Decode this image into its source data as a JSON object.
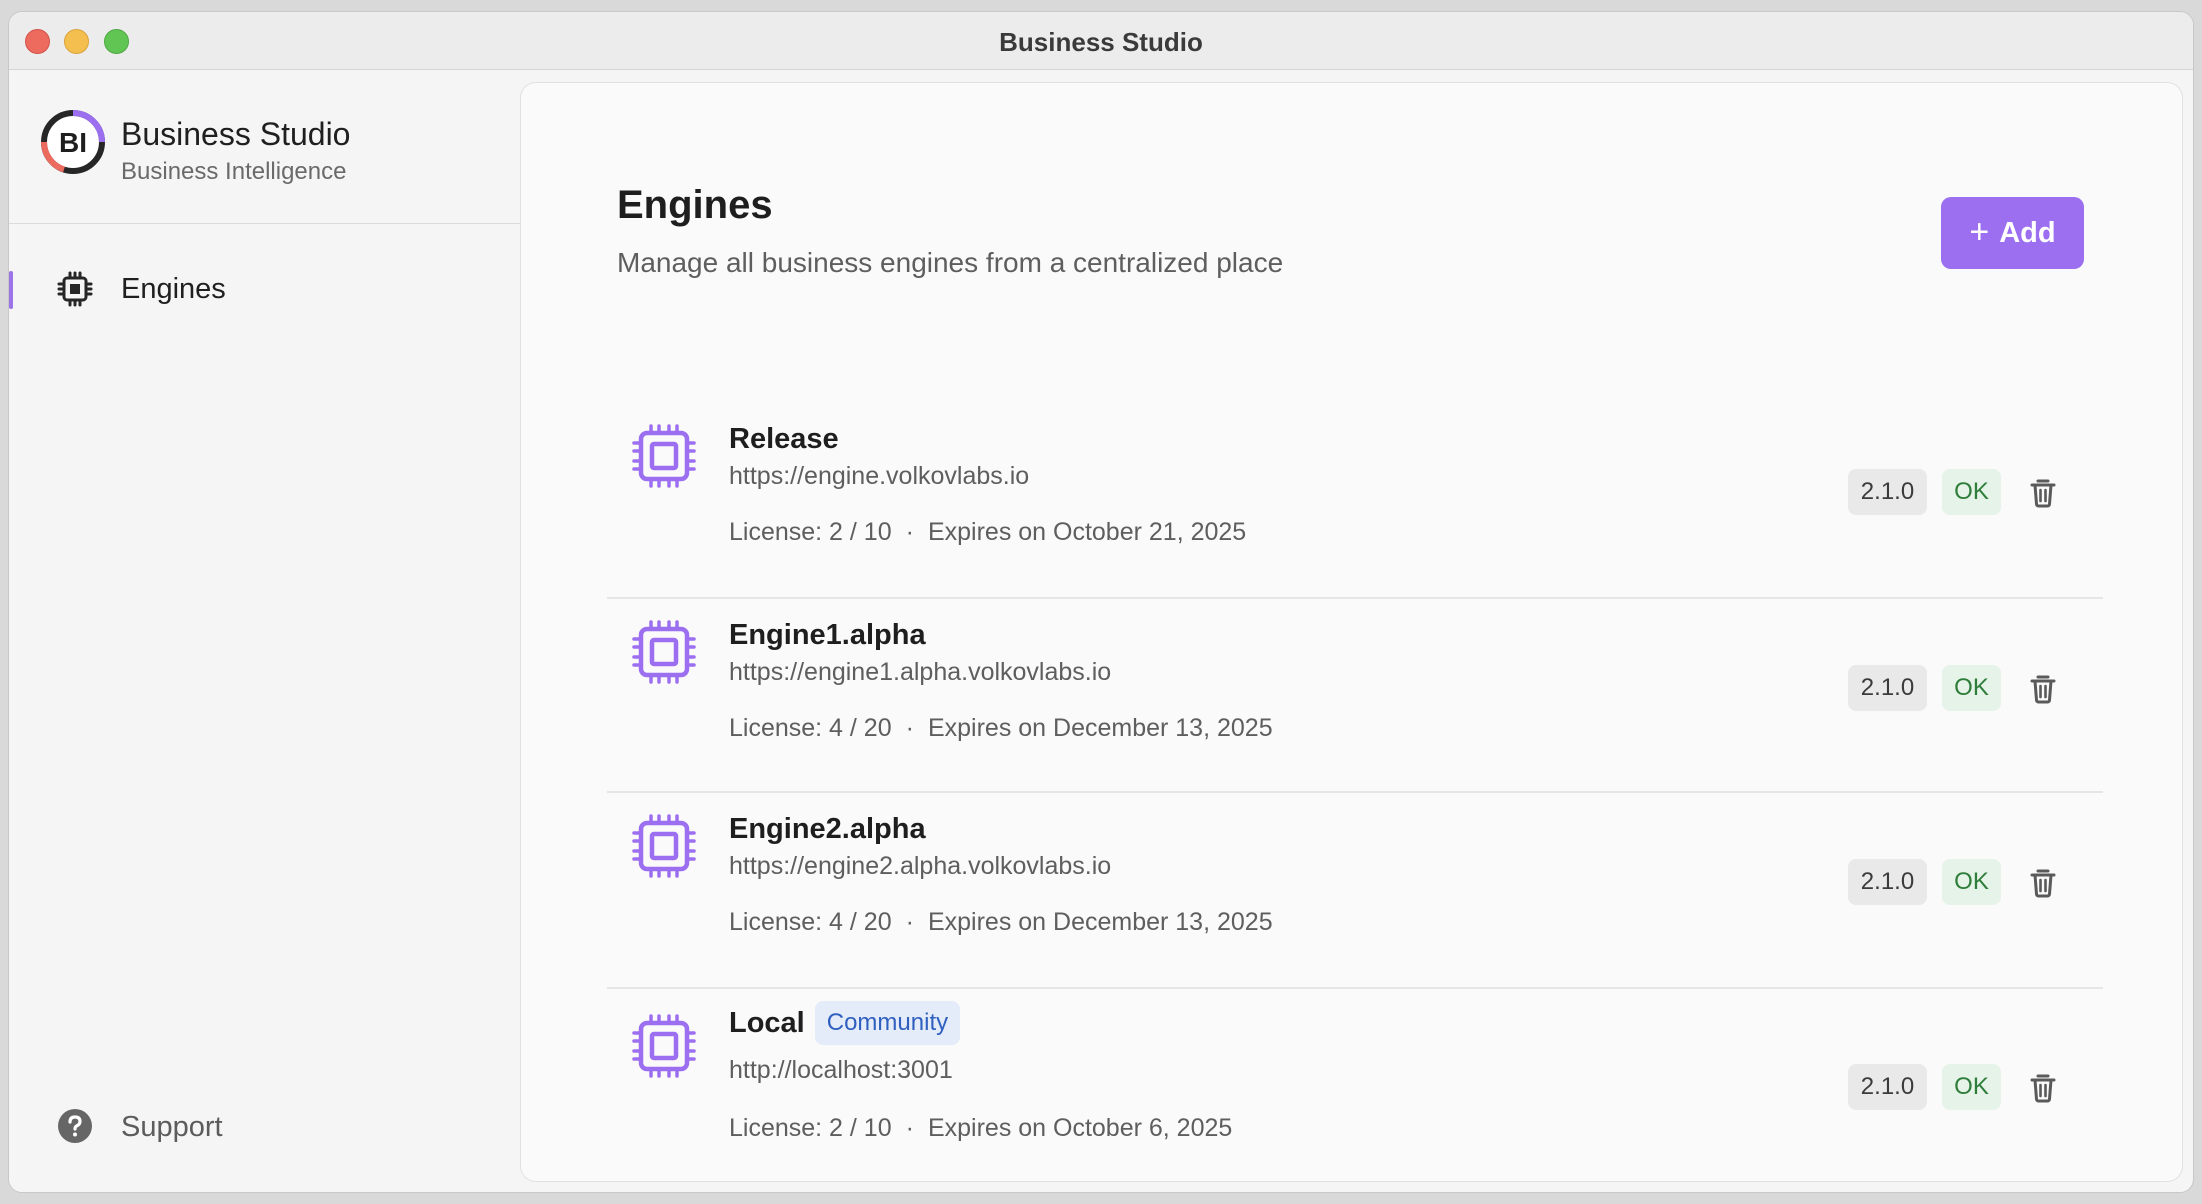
{
  "window": {
    "title": "Business Studio"
  },
  "sidebar": {
    "brand": {
      "name": "Business Studio",
      "subtitle": "Business Intelligence",
      "logo_text": "BI"
    },
    "nav": [
      {
        "label": "Engines",
        "icon": "chip-icon",
        "active": true
      }
    ],
    "support": {
      "label": "Support",
      "icon": "question-circle-icon"
    }
  },
  "main": {
    "title": "Engines",
    "subtitle": "Manage all business engines from a centralized place",
    "add_button": "Add",
    "engines": [
      {
        "name": "Release",
        "url": "https://engine.volkovlabs.io",
        "license": "License: 2 / 10",
        "expires": "Expires on October 21, 2025",
        "version": "2.1.0",
        "status": "OK",
        "badge": ""
      },
      {
        "name": "Engine1.alpha",
        "url": "https://engine1.alpha.volkovlabs.io",
        "license": "License: 4 / 20",
        "expires": "Expires on December 13, 2025",
        "version": "2.1.0",
        "status": "OK",
        "badge": ""
      },
      {
        "name": "Engine2.alpha",
        "url": "https://engine2.alpha.volkovlabs.io",
        "license": "License: 4 / 20",
        "expires": "Expires on December 13, 2025",
        "version": "2.1.0",
        "status": "OK",
        "badge": ""
      },
      {
        "name": "Local",
        "url": "http://localhost:3001",
        "license": "License: 2 / 10",
        "expires": "Expires on October 6, 2025",
        "version": "2.1.0",
        "status": "OK",
        "badge": "Community"
      }
    ],
    "separator": "·"
  },
  "colors": {
    "accent": "#9b6ff0",
    "ok_text": "#2e7d3a",
    "ok_bg": "#e5f3e8",
    "community_text": "#2f5fbf",
    "community_bg": "#e5ecf9"
  }
}
